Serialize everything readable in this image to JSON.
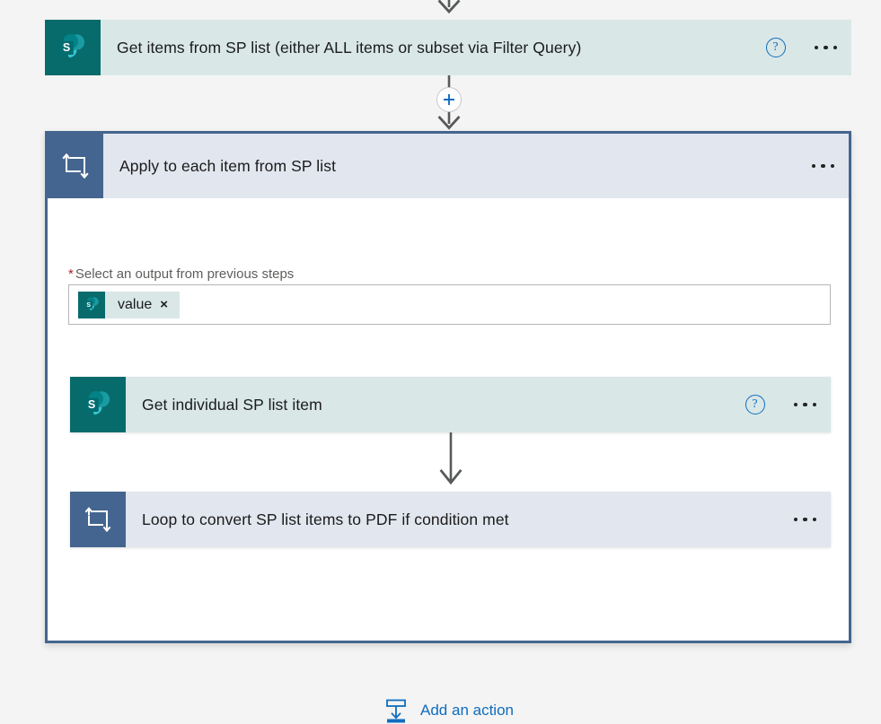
{
  "canvas": {
    "background_color": "#f4f4f4",
    "accent_blue": "#0f6cbd",
    "sharepoint_teal": "#076b6c",
    "sharepoint_card_bg": "#d9e7e7",
    "loop_blue": "#44658f",
    "loop_card_bg": "#e2e6ef",
    "required_red": "#a4262c",
    "arrow_gray": "#57595a"
  },
  "top_action": {
    "title": "Get items from SP list (either ALL items or subset via Filter Query)",
    "icon": "sharepoint-icon",
    "help_label": "?",
    "menu_label": "More commands"
  },
  "insert_button": {
    "label": "+",
    "icon": "plus-icon"
  },
  "scope": {
    "title": "Apply to each item from SP list",
    "icon": "loop-icon",
    "menu_label": "More commands",
    "field": {
      "required_marker": "*",
      "label": "Select an output from previous steps",
      "placeholder": "Select an output from previous steps",
      "token": {
        "text": "value",
        "icon": "sharepoint-icon",
        "remove_label": "×"
      }
    },
    "children": [
      {
        "title": "Get individual SP list item",
        "icon": "sharepoint-icon",
        "type": "sharepoint",
        "has_help": true,
        "help_label": "?",
        "menu_label": "More commands"
      },
      {
        "title": "Loop to convert SP list items to PDF if condition met",
        "icon": "loop-icon",
        "type": "loop",
        "has_help": false,
        "help_label": "",
        "menu_label": "More commands"
      }
    ],
    "add_action": {
      "label": "Add an action",
      "icon": "add-action-icon"
    }
  }
}
